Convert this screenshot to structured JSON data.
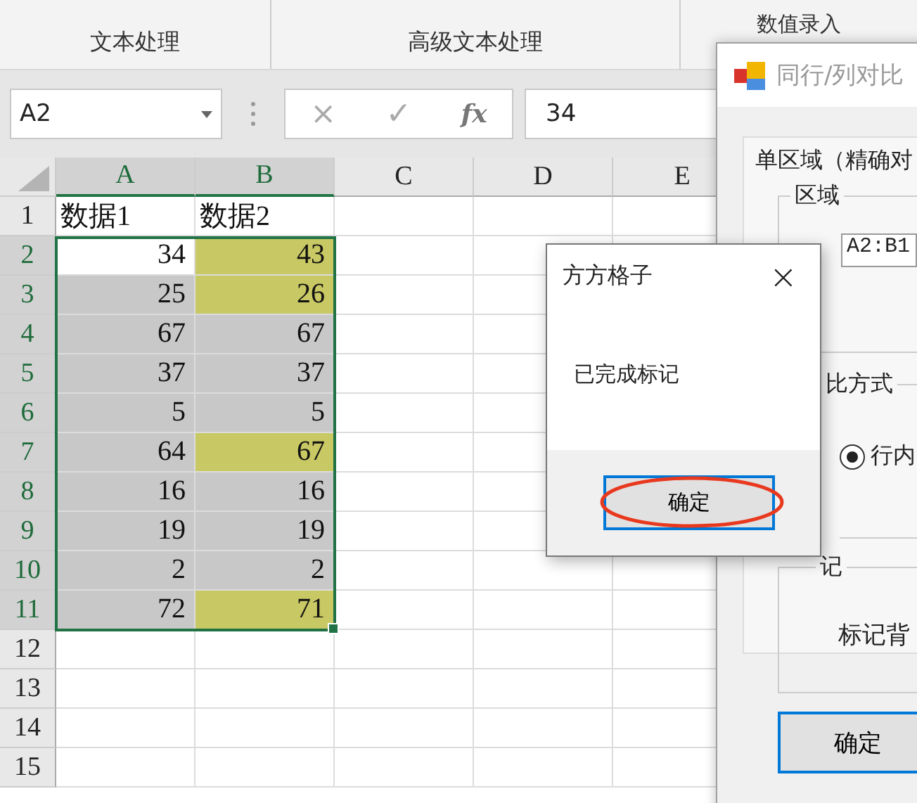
{
  "ribbon": {
    "groups": [
      "文本处理",
      "高级文本处理",
      "数值录入"
    ]
  },
  "formula_bar": {
    "name_box": "A2",
    "value": "34",
    "cancel": "×",
    "enter": "✓",
    "function": "fx"
  },
  "sheet": {
    "columns": [
      {
        "label": "A",
        "selected": true
      },
      {
        "label": "B",
        "selected": true
      },
      {
        "label": "C",
        "selected": false
      },
      {
        "label": "D",
        "selected": false
      },
      {
        "label": "E",
        "selected": false
      }
    ],
    "rows": [
      {
        "label": "1",
        "selected": false,
        "cells": [
          {
            "text": "数据1",
            "color": "#ffffff"
          },
          {
            "text": "数据2",
            "color": "#ffffff"
          }
        ]
      },
      {
        "label": "2",
        "selected": true,
        "cells": [
          {
            "text": "34",
            "color": "#ffffff"
          },
          {
            "text": "43",
            "color": "#c8c864"
          }
        ]
      },
      {
        "label": "3",
        "selected": true,
        "cells": [
          {
            "text": "25",
            "color": "#c8c8c8"
          },
          {
            "text": "26",
            "color": "#c8c864"
          }
        ]
      },
      {
        "label": "4",
        "selected": true,
        "cells": [
          {
            "text": "67",
            "color": "#c8c8c8"
          },
          {
            "text": "67",
            "color": "#c8c8c8"
          }
        ]
      },
      {
        "label": "5",
        "selected": true,
        "cells": [
          {
            "text": "37",
            "color": "#c8c8c8"
          },
          {
            "text": "37",
            "color": "#c8c8c8"
          }
        ]
      },
      {
        "label": "6",
        "selected": true,
        "cells": [
          {
            "text": "5",
            "color": "#c8c8c8"
          },
          {
            "text": "5",
            "color": "#c8c8c8"
          }
        ]
      },
      {
        "label": "7",
        "selected": true,
        "cells": [
          {
            "text": "64",
            "color": "#c8c8c8"
          },
          {
            "text": "67",
            "color": "#c8c864"
          }
        ]
      },
      {
        "label": "8",
        "selected": true,
        "cells": [
          {
            "text": "16",
            "color": "#c8c8c8"
          },
          {
            "text": "16",
            "color": "#c8c8c8"
          }
        ]
      },
      {
        "label": "9",
        "selected": true,
        "cells": [
          {
            "text": "19",
            "color": "#c8c8c8"
          },
          {
            "text": "19",
            "color": "#c8c8c8"
          }
        ]
      },
      {
        "label": "10",
        "selected": true,
        "cells": [
          {
            "text": "2",
            "color": "#c8c8c8"
          },
          {
            "text": "2",
            "color": "#c8c8c8"
          }
        ]
      },
      {
        "label": "11",
        "selected": true,
        "cells": [
          {
            "text": "72",
            "color": "#c8c8c8"
          },
          {
            "text": "71",
            "color": "#c8c864"
          }
        ]
      },
      {
        "label": "12",
        "selected": false,
        "cells": []
      },
      {
        "label": "13",
        "selected": false,
        "cells": []
      },
      {
        "label": "14",
        "selected": false,
        "cells": []
      },
      {
        "label": "15",
        "selected": false,
        "cells": []
      }
    ]
  },
  "compare_dialog": {
    "title": "同行/列对比",
    "panel_title": "单区域（精确对",
    "range_group": "区域",
    "range": "A2:B1",
    "mode_group": "比方式",
    "radio": {
      "label": "行内",
      "selected": true
    },
    "mark_group": "记",
    "mark_label": "标记背",
    "ok": "确定"
  },
  "message_box": {
    "title": "方方格子",
    "close": "×",
    "message": "已完成标记",
    "ok": "确定"
  }
}
